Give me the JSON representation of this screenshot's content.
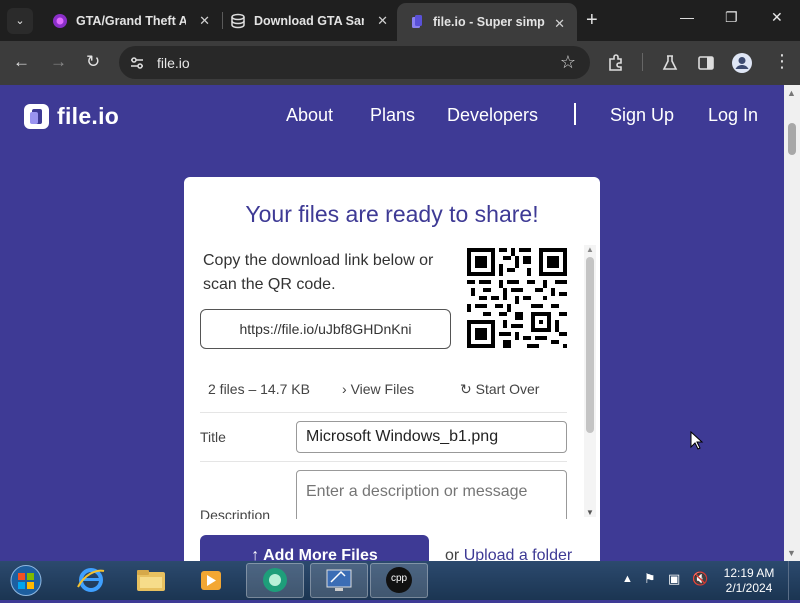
{
  "browser": {
    "tabs": [
      {
        "title": "GTA/Grand Theft Auto",
        "active": false
      },
      {
        "title": "Download GTA San Andreas",
        "active": false
      },
      {
        "title": "file.io - Super simple file sharing",
        "active": true
      }
    ],
    "address": "file.io"
  },
  "site": {
    "logo_text": "file.io",
    "nav": {
      "about": "About",
      "plans": "Plans",
      "developers": "Developers",
      "divider": "|",
      "signup": "Sign Up",
      "login": "Log In"
    }
  },
  "card": {
    "title": "Your files are ready to share!",
    "instructions": "Copy the download link below or scan the QR code.",
    "link": "https://file.io/uJbf8GHDnKni",
    "summary": {
      "count": "2 files – 14.7 KB",
      "view_files": "View Files",
      "start_over": "Start Over"
    },
    "title_label": "Title",
    "title_value": "Microsoft Windows_b1.png",
    "description_label": "Description",
    "description_placeholder": "Enter a description or message",
    "add_more": "Add More Files",
    "or": "or",
    "upload_folder": "Upload a folder"
  },
  "taskbar": {
    "time": "12:19 AM",
    "date": "2/1/2024",
    "apps": [
      "internet-explorer",
      "file-explorer",
      "media-player",
      "browser",
      "control-panel",
      "cpp-app"
    ],
    "cpp_label": "cpp"
  },
  "colors": {
    "brand": "#3e3a95",
    "chrome_dark": "#1f1f1f",
    "chrome_toolbar": "#3c3c3c"
  }
}
